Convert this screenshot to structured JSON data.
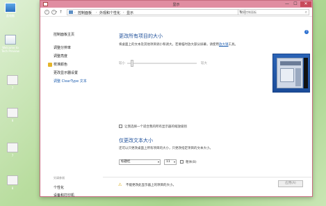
{
  "desktop": {
    "icons": [
      {
        "label": "此电脑"
      },
      {
        "label": "Welcome to Tech Preview"
      },
      {
        "label": "7"
      },
      {
        "label": "9"
      },
      {
        "label": "7"
      },
      {
        "label": "8"
      }
    ]
  },
  "window": {
    "title": "显示",
    "controls": {
      "minimize": "—",
      "maximize": "☐",
      "close": "✕"
    }
  },
  "addressbar": {
    "crumbs": [
      "控制面板",
      "外观和个性化",
      "显示"
    ],
    "search_placeholder": "搜索控制面板"
  },
  "sidebar": {
    "home": "控制面板主页",
    "links": [
      "调整分辨率",
      "调整亮度",
      "校准颜色",
      "更改显示器设置",
      "调整 ClearType 文本"
    ],
    "see_also_title": "另请参阅",
    "see_also": [
      "个性化",
      "设备和打印机"
    ]
  },
  "main": {
    "heading1": "更改所有项目的大小",
    "desc1_prefix": "将桌面上的文本及其他项目调小和调大。若要临时放大部分屏幕，请使用",
    "desc1_link": "放大镜",
    "desc1_suffix": "工具。",
    "slider_small": "较小",
    "slider_large": "较大",
    "slider_level": 0.05,
    "checkbox_label": "让我选择一个适合我的所有显示器的缩放级别",
    "heading2": "仅更改文本大小",
    "desc2": "还可以只更改桌面上所有项目的大小，只更改指定项目的文本大小。",
    "item_select": "标题栏",
    "size_select": "11",
    "bold_label": "粗体(B)",
    "warning": "不能更改此显示器上的项目的大小。",
    "apply": "应用(A)"
  },
  "colors": {
    "titlebar": "#e08da1",
    "accent": "#1e4f9a"
  }
}
